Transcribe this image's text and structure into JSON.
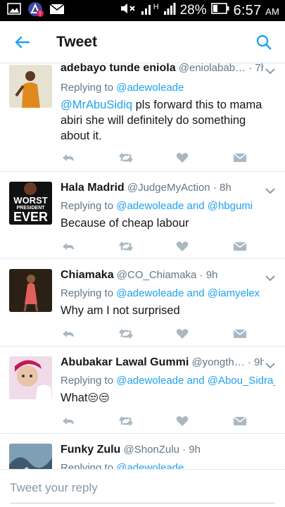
{
  "status_bar": {
    "carrier_h": "H",
    "battery": "28%",
    "time": "6:57",
    "ampm": "AM"
  },
  "app_bar": {
    "title": "Tweet"
  },
  "accent_color": "#1da1f2",
  "tweets": [
    {
      "name": "adebayo tunde eniola",
      "handle": "@eniolabab…",
      "time": "· 7h",
      "reply_prefix": "Replying to ",
      "reply_to": "@adewoleade",
      "text_mention": "@MrAbuSidiq",
      "text": " pls forward this to mama abiri she will definitely do something about it."
    },
    {
      "name": "Hala Madrid",
      "handle": "@JudgeMyAction",
      "time": "· 8h",
      "reply_prefix": "Replying to ",
      "reply_to": "@adewoleade and @hbgumi",
      "text": "Because of cheap labour",
      "avatar_text": [
        "WORST",
        "PRESIDENT",
        "EVER"
      ]
    },
    {
      "name": "Chiamaka",
      "handle": "@CO_Chiamaka",
      "time": "· 9h",
      "reply_prefix": "Replying to ",
      "reply_to": "@adewoleade and @iamyelex",
      "text": "Why am I not surprised"
    },
    {
      "name": "Abubakar Lawal Gummi",
      "handle": "@yongth…",
      "time": "· 9h",
      "reply_prefix": "Replying to ",
      "reply_to": "@adewoleade and @Abou_Sidra_",
      "text": "What",
      "emoji": "😒😒"
    },
    {
      "name": "Funky Zulu",
      "handle": "@ShonZulu",
      "time": "· 9h",
      "reply_prefix": "Replying to ",
      "reply_to": "@adewoleade"
    }
  ],
  "compose": {
    "placeholder": "Tweet your reply"
  }
}
